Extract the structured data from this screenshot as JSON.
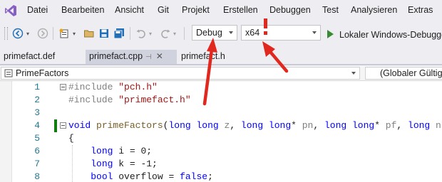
{
  "menu": {
    "logo_icon": "visual-studio-logo",
    "items": [
      "Datei",
      "Bearbeiten",
      "Ansicht",
      "Git",
      "Projekt",
      "Erstellen",
      "Debuggen",
      "Test",
      "Analysieren",
      "Extras"
    ]
  },
  "toolbar": {
    "config_value": "Debug",
    "platform_value": "x64",
    "run_label": "Lokaler Windows-Debugger",
    "icons": [
      "back-icon",
      "forward-icon",
      "new-item-icon",
      "open-folder-icon",
      "save-icon",
      "save-all-icon",
      "undo-icon",
      "redo-icon"
    ]
  },
  "tabs": [
    {
      "label": "primefact.def"
    },
    {
      "label": "primefact.cpp"
    },
    {
      "label": "primefact.h"
    }
  ],
  "navbar": {
    "scope": "PrimeFactors",
    "context": "(Globaler Gültigk"
  },
  "editor": {
    "line_numbers": [
      "1",
      "2",
      "3",
      "4",
      "5",
      "6",
      "7",
      "8"
    ]
  },
  "colors": {
    "annotation_red": "#e0281f",
    "run_green": "#388a34",
    "change_bar": "#107c10",
    "keyword_blue": "#0000ff",
    "string_red": "#a31515"
  }
}
